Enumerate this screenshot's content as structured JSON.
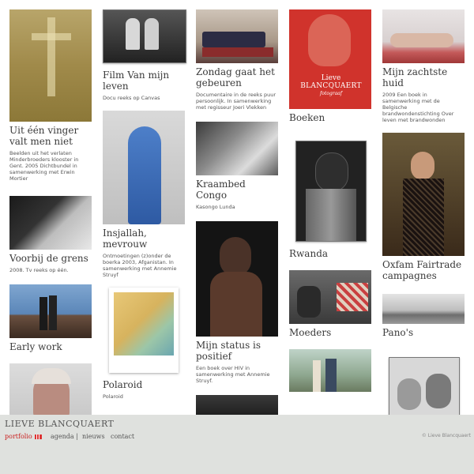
{
  "site": {
    "brand": "LIEVE BLANCQUAERT",
    "copyright": "© Lieve Blancquaert"
  },
  "nav": {
    "portfolio": "portfolio",
    "agenda": "agenda",
    "separator": "|",
    "nieuws": "nieuws",
    "contact": "contact"
  },
  "items": {
    "vinger": {
      "title": "Uit één vinger valt men niet",
      "desc": "Beelden uit het verlaten Minderbroeders klooster in Gent. 2005 Dichtbundel in samenwerking met Erwin Mortier"
    },
    "grens": {
      "title": "Voorbij de grens",
      "desc": "2008. Tv reeks op één."
    },
    "early": {
      "title": "Early work"
    },
    "film": {
      "title": "Film Van mijn leven",
      "desc": "Docu reeks op Canvas"
    },
    "insjallah": {
      "title": "Insjallah, mevrouw",
      "desc": "Ontmoetingen (z)onder de boerka 2003, Afganistan. In samenwerking met Annemie Struyf"
    },
    "polaroid": {
      "title": "Polaroid",
      "desc": "Polaroid"
    },
    "zondag": {
      "title": "Zondag gaat het gebeuren",
      "desc": "Documentaire in de reeks puur persoonlijk. In samenwerking met regisseur Joeri Vlekken"
    },
    "kraambed": {
      "title": "Kraambed Congo",
      "desc": "Kasongo Lunda"
    },
    "status": {
      "title": "Mijn status is positief",
      "desc": "Een boek over HIV in samenwerking met Annemie Struyf."
    },
    "boeken": {
      "title": "Boeken",
      "cover_name": "Lieve",
      "cover_surname": "BLANCQUAERT",
      "cover_sub": "fotograaf"
    },
    "rwanda": {
      "title": "Rwanda"
    },
    "moeders": {
      "title": "Moeders"
    },
    "huid": {
      "title": "Mijn zachtste huid",
      "desc": "2009 Een boek in samenwerking met de Belgische brandwondenstichting Over leven met brandwonden"
    },
    "oxfam": {
      "title": "Oxfam Fairtrade campagnes"
    },
    "panos": {
      "title": "Pano's"
    }
  }
}
